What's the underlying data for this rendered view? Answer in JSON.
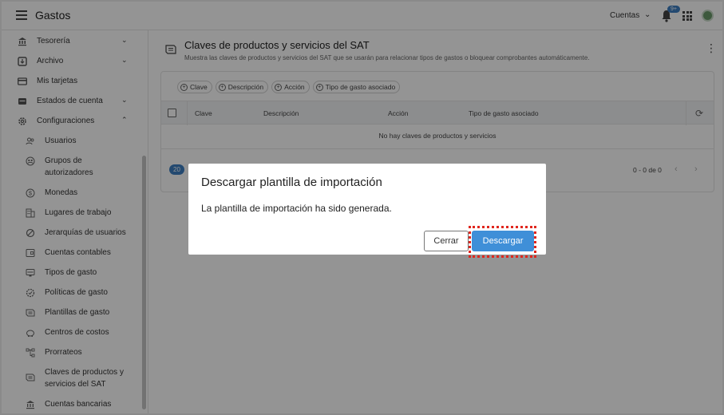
{
  "app": {
    "title": "Gastos",
    "account_label": "Cuentas",
    "notification_count": "9+"
  },
  "sidebar": {
    "items": [
      {
        "label": "Tesorería",
        "icon": "bank-icon",
        "chevron": "down"
      },
      {
        "label": "Archivo",
        "icon": "archive-icon",
        "chevron": "down"
      },
      {
        "label": "Mis tarjetas",
        "icon": "credit-card-icon"
      },
      {
        "label": "Estados de cuenta",
        "icon": "statement-icon",
        "chevron": "down"
      },
      {
        "label": "Configuraciones",
        "icon": "gear-icon",
        "chevron": "up"
      }
    ],
    "subitems": [
      {
        "label": "Usuarios",
        "icon": "users-icon"
      },
      {
        "label": "Grupos de autorizadores",
        "icon": "approvers-icon"
      },
      {
        "label": "Monedas",
        "icon": "currency-icon"
      },
      {
        "label": "Lugares de trabajo",
        "icon": "building-icon"
      },
      {
        "label": "Jerarquías de usuarios",
        "icon": "hierarchy-icon"
      },
      {
        "label": "Cuentas contables",
        "icon": "ledger-icon"
      },
      {
        "label": "Tipos de gasto",
        "icon": "expense-type-icon"
      },
      {
        "label": "Políticas de gasto",
        "icon": "policy-icon"
      },
      {
        "label": "Plantillas de gasto",
        "icon": "template-icon"
      },
      {
        "label": "Centros de costos",
        "icon": "piggy-bank-icon"
      },
      {
        "label": "Prorrateos",
        "icon": "allocation-icon"
      },
      {
        "label": "Claves de productos y servicios del SAT",
        "icon": "sat-keys-icon"
      },
      {
        "label": "Cuentas bancarias",
        "icon": "bank-account-icon"
      }
    ]
  },
  "main": {
    "title": "Claves de productos y servicios del SAT",
    "subtitle": "Muestra las claves de productos y servicios del SAT que se usarán para relacionar tipos de gastos o bloquear comprobantes automáticamente.",
    "filter_chips": [
      "Clave",
      "Descripción",
      "Acción",
      "Tipo de gasto asociado"
    ],
    "columns": [
      "Clave",
      "Descripción",
      "Acción",
      "Tipo de gasto asociado"
    ],
    "empty_message": "No hay claves de productos y servicios",
    "page_size": "20",
    "range": "0 - 0 de 0"
  },
  "dialog": {
    "title": "Descargar plantilla de importación",
    "message": "La plantilla de importación ha sido generada.",
    "cancel_label": "Cerrar",
    "confirm_label": "Descargar"
  },
  "colors": {
    "accent": "#3f8fd8",
    "highlight": "#e0261d"
  }
}
